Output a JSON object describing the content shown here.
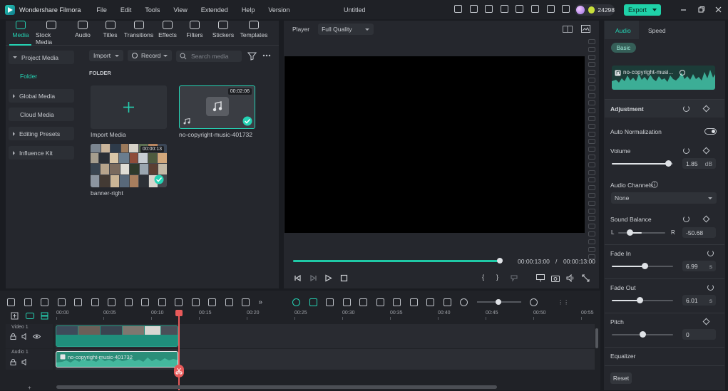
{
  "app": {
    "name": "Wondershare Filmora",
    "document_title": "Untitled"
  },
  "menu": [
    "File",
    "Edit",
    "Tools",
    "View",
    "Extended",
    "Help",
    "Version"
  ],
  "titlebar": {
    "credits": "24298",
    "export_label": "Export"
  },
  "media_tabs": [
    {
      "label": "Media",
      "icon": "media-icon",
      "active": true
    },
    {
      "label": "Stock Media",
      "icon": "stock-media-icon"
    },
    {
      "label": "Audio",
      "icon": "audio-icon"
    },
    {
      "label": "Titles",
      "icon": "titles-icon"
    },
    {
      "label": "Transitions",
      "icon": "transitions-icon"
    },
    {
      "label": "Effects",
      "icon": "effects-icon"
    },
    {
      "label": "Filters",
      "icon": "filters-icon"
    },
    {
      "label": "Stickers",
      "icon": "stickers-icon"
    },
    {
      "label": "Templates",
      "icon": "templates-icon"
    }
  ],
  "sidebar": {
    "project_media": "Project Media",
    "folder": "Folder",
    "global_media": "Global Media",
    "cloud_media": "Cloud Media",
    "editing_presets": "Editing Presets",
    "influence_kit": "Influence Kit"
  },
  "library": {
    "import_label": "Import",
    "record_label": "Record",
    "search_placeholder": "Search media",
    "folder_heading": "FOLDER",
    "items": [
      {
        "label": "Import Media"
      },
      {
        "label": "no-copyright-music-401732",
        "duration": "00:02:06"
      },
      {
        "label": "banner-right",
        "duration": "00:00:13"
      }
    ]
  },
  "player": {
    "label": "Player",
    "quality": "Full Quality",
    "current_time": "00:00:13:00",
    "separator": "/",
    "total_time": "00:00:13:00",
    "progress": 1.0
  },
  "properties": {
    "tabs": [
      "Audio",
      "Speed"
    ],
    "active_tab": "Audio",
    "basic_label": "Basic",
    "clip_name": "no-copyright-musi...",
    "adjustment": "Adjustment",
    "auto_normalization": "Auto Normalization",
    "volume_label": "Volume",
    "volume_value": "1.85",
    "volume_unit": "dB",
    "volume_level": 0.93,
    "audio_channels_label": "Audio Channels",
    "audio_channels_value": "None",
    "sound_balance_label": "Sound Balance",
    "balance_left": "L",
    "balance_right": "R",
    "balance_value": "-50.68",
    "balance_level": 0.25,
    "fade_in_label": "Fade In",
    "fade_in_value": "6.99",
    "fade_in_level": 0.54,
    "fade_out_label": "Fade Out",
    "fade_out_value": "6.01",
    "fade_out_level": 0.46,
    "seconds_unit": "s",
    "pitch_label": "Pitch",
    "pitch_value": "0",
    "pitch_level": 0.5,
    "equalizer_label": "Equalizer",
    "reset_label": "Reset"
  },
  "timeline": {
    "ruler": [
      "00:00",
      "00:05",
      "00:10",
      "00:15",
      "00:20",
      "00:25",
      "00:30",
      "00:35",
      "00:40",
      "00:45",
      "00:50",
      "00:55"
    ],
    "video_track": "Video 1",
    "audio_track": "Audio 1",
    "audio_clip_label": "no-copyright-music-401732"
  },
  "colors": {
    "accent": "#25d3b4",
    "playhead": "#e85a5a",
    "clip": "#2a8e79"
  }
}
